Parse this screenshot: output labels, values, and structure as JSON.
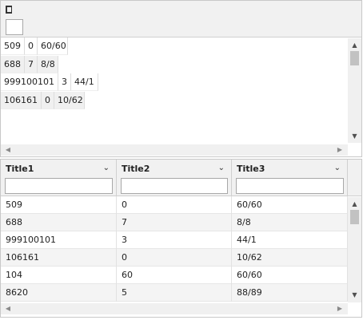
{
  "top_panel": {
    "rows": [
      [
        "509",
        "0",
        "60/60"
      ],
      [
        "688",
        "7",
        "8/8"
      ],
      [
        "999100101",
        "3",
        "44/1"
      ],
      [
        "106161",
        "0",
        "10/62"
      ]
    ],
    "scroll_up": "▲",
    "scroll_down": "▼",
    "scroll_left": "◀",
    "scroll_right": "▶"
  },
  "grid": {
    "columns": [
      {
        "title": "Title1",
        "filter": ""
      },
      {
        "title": "Title2",
        "filter": ""
      },
      {
        "title": "Title3",
        "filter": ""
      }
    ],
    "chevron": "⌄",
    "rows": [
      [
        "509",
        "0",
        "60/60"
      ],
      [
        "688",
        "7",
        "8/8"
      ],
      [
        "999100101",
        "3",
        "44/1"
      ],
      [
        "106161",
        "0",
        "10/62"
      ],
      [
        "104",
        "60",
        "60/60"
      ],
      [
        "8620",
        "5",
        "88/89"
      ]
    ],
    "scroll_up": "▲",
    "scroll_down": "▼",
    "scroll_left": "◀",
    "scroll_right": "▶"
  }
}
